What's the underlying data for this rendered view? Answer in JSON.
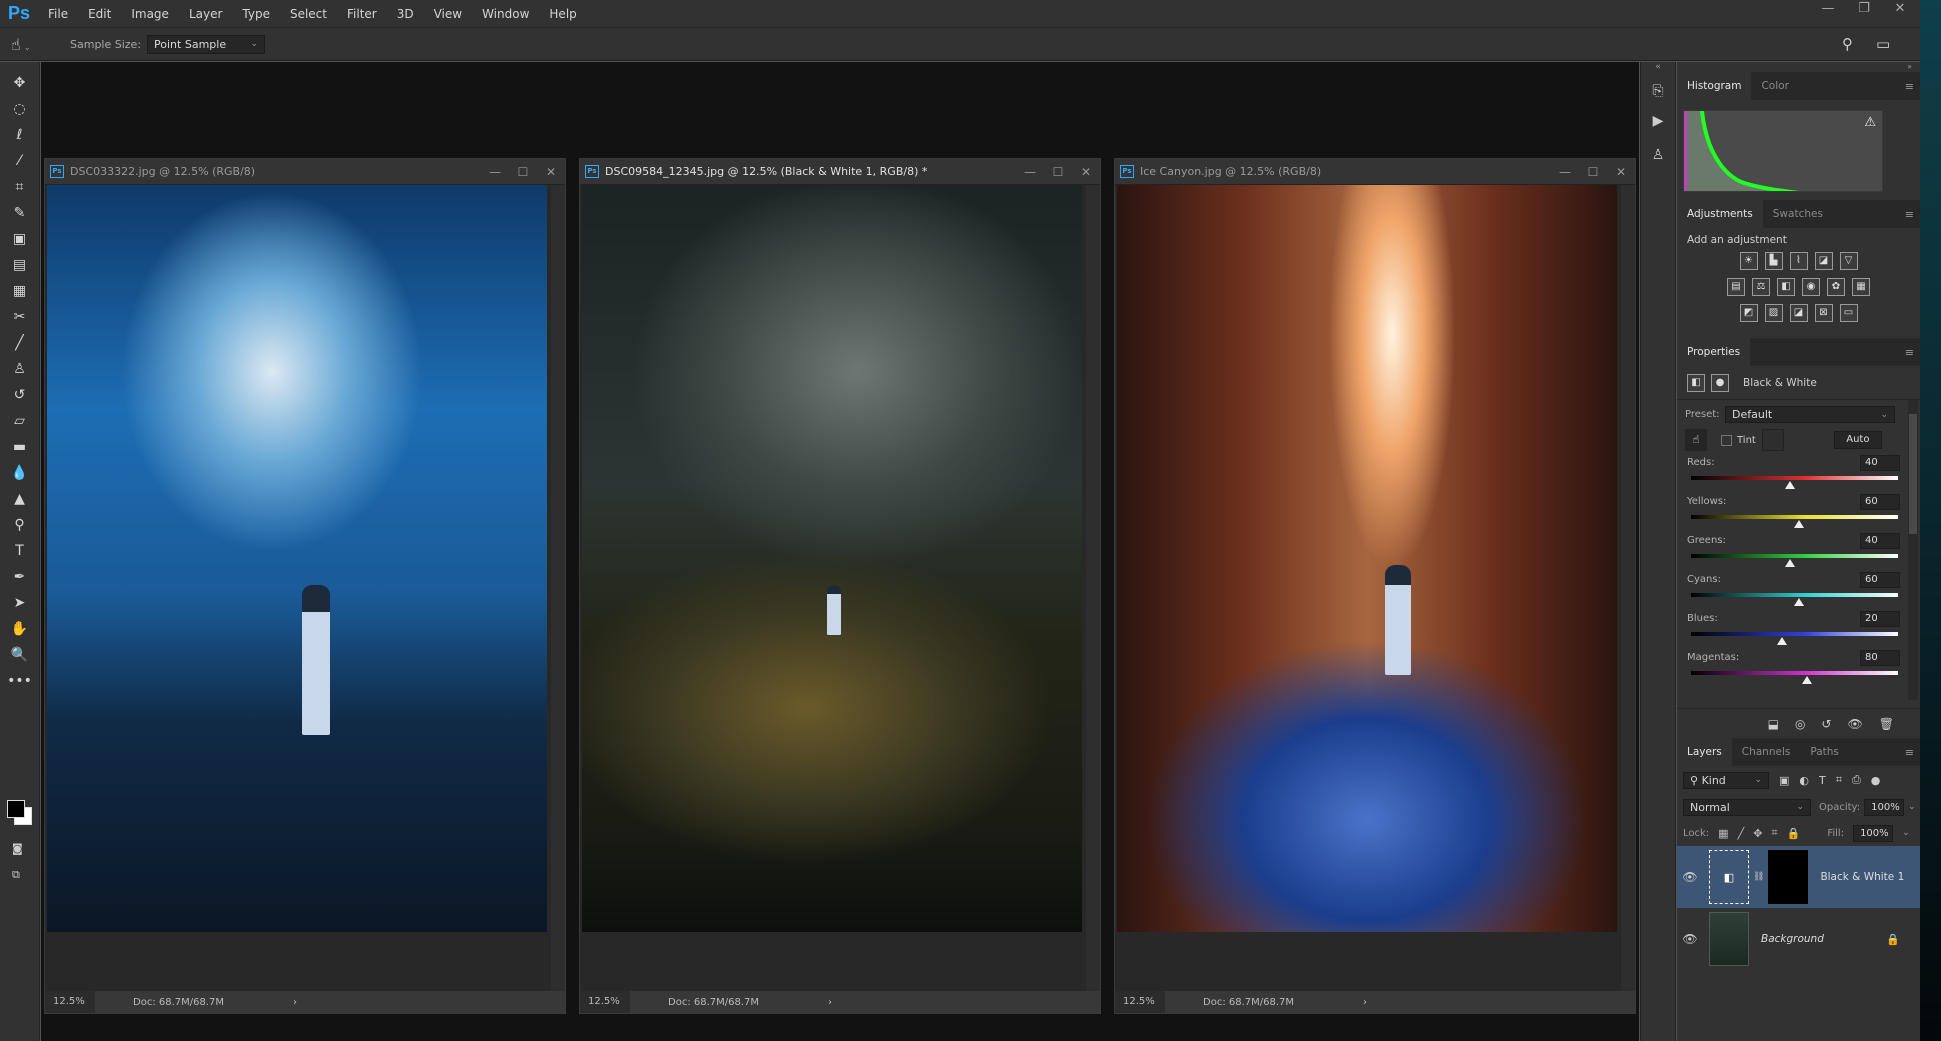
{
  "app": {
    "logo": "Ps"
  },
  "menu": [
    "File",
    "Edit",
    "Image",
    "Layer",
    "Type",
    "Select",
    "Filter",
    "3D",
    "View",
    "Window",
    "Help"
  ],
  "window_controls": {
    "minimize": "—",
    "restore": "❐",
    "close": "✕"
  },
  "options_bar": {
    "tool_icon": "eyedropper-hand-icon",
    "sample_size_label": "Sample Size:",
    "sample_size_value": "Point Sample",
    "search_icon": "⚲",
    "workspace_icon": "▭"
  },
  "tools": [
    {
      "name": "move",
      "glyph": "✥"
    },
    {
      "name": "marquee",
      "glyph": "◌"
    },
    {
      "name": "lasso",
      "glyph": "ℓ"
    },
    {
      "name": "magic-wand",
      "glyph": "⁄"
    },
    {
      "name": "crop",
      "glyph": "⌗"
    },
    {
      "name": "eyedropper",
      "glyph": "✎"
    },
    {
      "name": "spot-healing",
      "glyph": "▣"
    },
    {
      "name": "healing-brush",
      "glyph": "▤"
    },
    {
      "name": "patch",
      "glyph": "▦"
    },
    {
      "name": "content-aware-move",
      "glyph": "✂"
    },
    {
      "name": "brush",
      "glyph": "╱"
    },
    {
      "name": "clone-stamp",
      "glyph": "♙"
    },
    {
      "name": "history-brush",
      "glyph": "↺"
    },
    {
      "name": "eraser",
      "glyph": "▱"
    },
    {
      "name": "gradient",
      "glyph": "▬"
    },
    {
      "name": "blur",
      "glyph": "💧"
    },
    {
      "name": "sharpen",
      "glyph": "▲"
    },
    {
      "name": "dodge",
      "glyph": "⚲"
    },
    {
      "name": "type",
      "glyph": "T"
    },
    {
      "name": "pen",
      "glyph": "✒"
    },
    {
      "name": "path-selection",
      "glyph": "➤"
    },
    {
      "name": "hand",
      "glyph": "✋"
    },
    {
      "name": "zoom",
      "glyph": "🔍"
    },
    {
      "name": "more",
      "glyph": "•••"
    }
  ],
  "documents": [
    {
      "title": "DSC033322.jpg @ 12.5% (RGB/8)",
      "zoom": "12.5%",
      "doc_size": "Doc: 68.7M/68.7M",
      "active": false
    },
    {
      "title": "DSC09584_12345.jpg @ 12.5% (Black & White 1, RGB/8) *",
      "zoom": "12.5%",
      "doc_size": "Doc: 68.7M/68.7M",
      "active": true
    },
    {
      "title": "Ice Canyon.jpg @ 12.5% (RGB/8)",
      "zoom": "12.5%",
      "doc_size": "Doc: 68.7M/68.7M",
      "active": false
    }
  ],
  "histogram": {
    "tabs": [
      "Histogram",
      "Color"
    ],
    "warning_icon": "⚠"
  },
  "adjustments": {
    "tabs": [
      "Adjustments",
      "Swatches"
    ],
    "heading": "Add an adjustment",
    "rows": [
      [
        "brightness-contrast",
        "levels",
        "curves",
        "exposure",
        "vibrance"
      ],
      [
        "hue-saturation",
        "color-balance",
        "black-white",
        "photo-filter",
        "channel-mixer",
        "color-lookup"
      ],
      [
        "invert",
        "posterize",
        "threshold",
        "selective-color",
        "gradient-map"
      ]
    ]
  },
  "properties": {
    "tab": "Properties",
    "adjustment_name": "Black & White",
    "preset_label": "Preset:",
    "preset_value": "Default",
    "tint_label": "Tint",
    "tint_checked": false,
    "auto_label": "Auto",
    "sliders": [
      {
        "label": "Reds:",
        "value": 40,
        "color": "#e03030"
      },
      {
        "label": "Yellows:",
        "value": 60,
        "color": "#e8e030"
      },
      {
        "label": "Greens:",
        "value": 40,
        "color": "#30d040"
      },
      {
        "label": "Cyans:",
        "value": 60,
        "color": "#30d0d0"
      },
      {
        "label": "Blues:",
        "value": 20,
        "color": "#3040e0"
      },
      {
        "label": "Magentas:",
        "value": 80,
        "color": "#d030d0"
      }
    ],
    "slider_range": [
      -200,
      300
    ]
  },
  "layers": {
    "tabs": [
      "Layers",
      "Channels",
      "Paths"
    ],
    "filter_label": "Kind",
    "blend_mode": "Normal",
    "opacity_label": "Opacity:",
    "opacity": "100%",
    "lock_label": "Lock:",
    "fill_label": "Fill:",
    "fill": "100%",
    "items": [
      {
        "name": "Black & White 1",
        "visible": true,
        "selected": true,
        "locked": false
      },
      {
        "name": "Background",
        "visible": true,
        "selected": false,
        "locked": true
      }
    ]
  }
}
